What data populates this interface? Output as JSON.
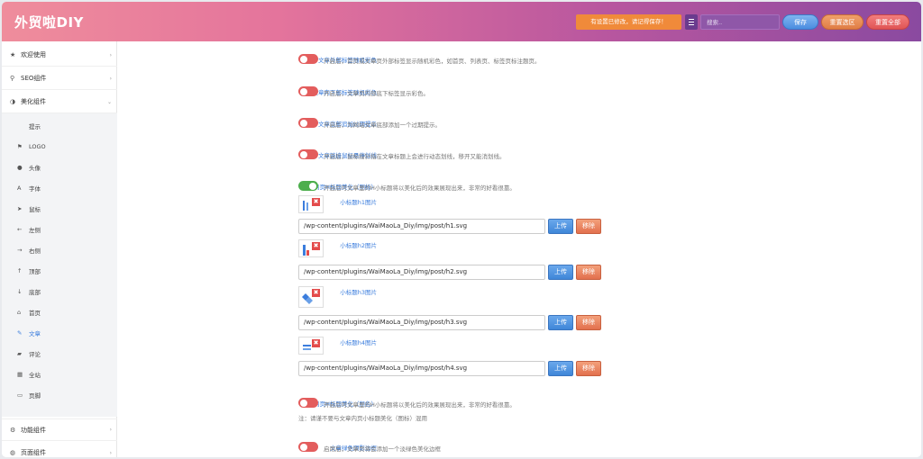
{
  "header": {
    "title": "外贸啦DIY",
    "notice": "有设置已修改，请记得保存！",
    "search_placeholder": "搜索..",
    "save_label": "保存",
    "reset_current_label": "重置选区",
    "reset_all_label": "重置全部"
  },
  "sidebar": {
    "top_items": [
      {
        "label": "欢迎使用",
        "icon": "star-icon"
      },
      {
        "label": "SEO组件",
        "icon": "search-icon"
      },
      {
        "label": "美化组件",
        "icon": "contrast-icon"
      }
    ],
    "sub_items": [
      {
        "label": "提示",
        "icon": ""
      },
      {
        "label": "LOGO",
        "icon": "flag-icon"
      },
      {
        "label": "头像",
        "icon": "user-icon"
      },
      {
        "label": "字体",
        "icon": "font-icon"
      },
      {
        "label": "鼠标",
        "icon": "cursor-icon"
      },
      {
        "label": "左侧",
        "icon": "arrow-left-icon"
      },
      {
        "label": "右侧",
        "icon": "arrow-right-icon"
      },
      {
        "label": "顶部",
        "icon": "arrow-up-icon"
      },
      {
        "label": "底部",
        "icon": "arrow-down-icon"
      },
      {
        "label": "首页",
        "icon": "home-icon"
      },
      {
        "label": "文章",
        "icon": "pen-icon"
      },
      {
        "label": "评论",
        "icon": "comment-icon"
      },
      {
        "label": "全站",
        "icon": "grid-icon"
      },
      {
        "label": "页脚",
        "icon": "page-icon"
      }
    ],
    "bottom_items": [
      {
        "label": "功能组件",
        "icon": "gear-icon"
      },
      {
        "label": "页面组件",
        "icon": "globe-icon"
      }
    ]
  },
  "settings": [
    {
      "label": "文章外部标签随机彩色",
      "desc": "开启后，首页或文章页外部标签显示随机彩色，如首页、列表页、标签页标注题页。"
    },
    {
      "label": "文章内下部标签随机彩色",
      "desc": "开启后，文章页内部底下标签显示彩色。"
    },
    {
      "label": "文章底部追加过期提示",
      "desc": "开启后，为网站文章底部添加一个过期提示。"
    },
    {
      "label": "文章链接鼠标悬停划线",
      "desc": "开启后，鼠标指针指在文章标题上会进行动态划线，移开又能消划线。"
    },
    {
      "label": "文章内页H标题美化（图标）",
      "desc": "开启后可文章里的H小标题将以美化后的效果展现出来，非常的好看很靠。"
    },
    {
      "label": "文章内页H标题美化（颜色）",
      "desc": "开启后可文章里的H小标题将以美化后的效果展现出来，非常的好看很靠。",
      "note": "注：请谨不要与文章内页小标题美化（图标）混用"
    },
    {
      "label": "文章绿色阴影边框",
      "desc": "启用后，文章页将会添加一个淡绿色美化边框"
    }
  ],
  "headings": [
    {
      "label": "小标题h1图片",
      "path": "/wp-content/plugins/WaiMaoLa_Diy/img/post/h1.svg"
    },
    {
      "label": "小标题h2图片",
      "path": "/wp-content/plugins/WaiMaoLa_Diy/img/post/h2.svg"
    },
    {
      "label": "小标题h3图片",
      "path": "/wp-content/plugins/WaiMaoLa_Diy/img/post/h3.svg"
    },
    {
      "label": "小标题h4图片",
      "path": "/wp-content/plugins/WaiMaoLa_Diy/img/post/h4.svg"
    }
  ],
  "upload_label": "上传",
  "remove_label": "移除",
  "thumb_x": "✖"
}
